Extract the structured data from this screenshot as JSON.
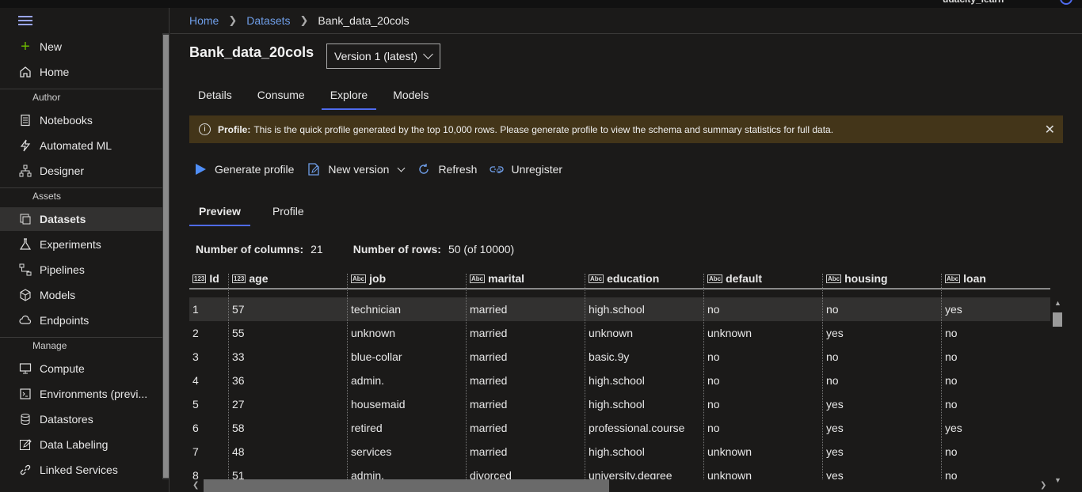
{
  "topbar": {
    "user": "udacity_learn"
  },
  "sidebar": {
    "new_label": "New",
    "home_label": "Home",
    "sections": {
      "author": "Author",
      "assets": "Assets",
      "manage": "Manage"
    },
    "author_items": [
      "Notebooks",
      "Automated ML",
      "Designer"
    ],
    "assets_items": [
      "Datasets",
      "Experiments",
      "Pipelines",
      "Models",
      "Endpoints"
    ],
    "manage_items": [
      "Compute",
      "Environments (previ...",
      "Datastores",
      "Data Labeling",
      "Linked Services"
    ],
    "active": "Datasets"
  },
  "breadcrumb": {
    "home": "Home",
    "datasets": "Datasets",
    "current": "Bank_data_20cols"
  },
  "page": {
    "title": "Bank_data_20cols",
    "version": "Version 1 (latest)"
  },
  "tabs": [
    "Details",
    "Consume",
    "Explore",
    "Models"
  ],
  "active_tab": "Explore",
  "banner": {
    "label": "Profile:",
    "text": "This is the quick profile generated by the top 10,000 rows. Please generate profile to view the schema and summary statistics for full data."
  },
  "toolbar": {
    "generate_profile": "Generate profile",
    "new_version": "New version",
    "refresh": "Refresh",
    "unregister": "Unregister"
  },
  "subtabs": [
    "Preview",
    "Profile"
  ],
  "active_subtab": "Preview",
  "stats": {
    "columns_label": "Number of columns:",
    "columns_value": "21",
    "rows_label": "Number of rows:",
    "rows_value": "50 (of 10000)"
  },
  "table": {
    "columns": [
      {
        "name": "Id",
        "type": "123"
      },
      {
        "name": "age",
        "type": "123"
      },
      {
        "name": "job",
        "type": "Abc"
      },
      {
        "name": "marital",
        "type": "Abc"
      },
      {
        "name": "education",
        "type": "Abc"
      },
      {
        "name": "default",
        "type": "Abc"
      },
      {
        "name": "housing",
        "type": "Abc"
      },
      {
        "name": "loan",
        "type": "Abc"
      }
    ],
    "rows": [
      [
        "1",
        "57",
        "technician",
        "married",
        "high.school",
        "no",
        "no",
        "yes"
      ],
      [
        "2",
        "55",
        "unknown",
        "married",
        "unknown",
        "unknown",
        "yes",
        "no"
      ],
      [
        "3",
        "33",
        "blue-collar",
        "married",
        "basic.9y",
        "no",
        "no",
        "no"
      ],
      [
        "4",
        "36",
        "admin.",
        "married",
        "high.school",
        "no",
        "no",
        "no"
      ],
      [
        "5",
        "27",
        "housemaid",
        "married",
        "high.school",
        "no",
        "yes",
        "no"
      ],
      [
        "6",
        "58",
        "retired",
        "married",
        "professional.course",
        "no",
        "yes",
        "yes"
      ],
      [
        "7",
        "48",
        "services",
        "married",
        "high.school",
        "unknown",
        "yes",
        "no"
      ],
      [
        "8",
        "51",
        "admin.",
        "divorced",
        "university.degree",
        "unknown",
        "yes",
        "no"
      ]
    ],
    "selected_row": 0
  },
  "colors": {
    "accent": "#4f6bed",
    "link": "#6f9ee8",
    "banner_bg": "#433519",
    "bg": "#1b1a19"
  }
}
